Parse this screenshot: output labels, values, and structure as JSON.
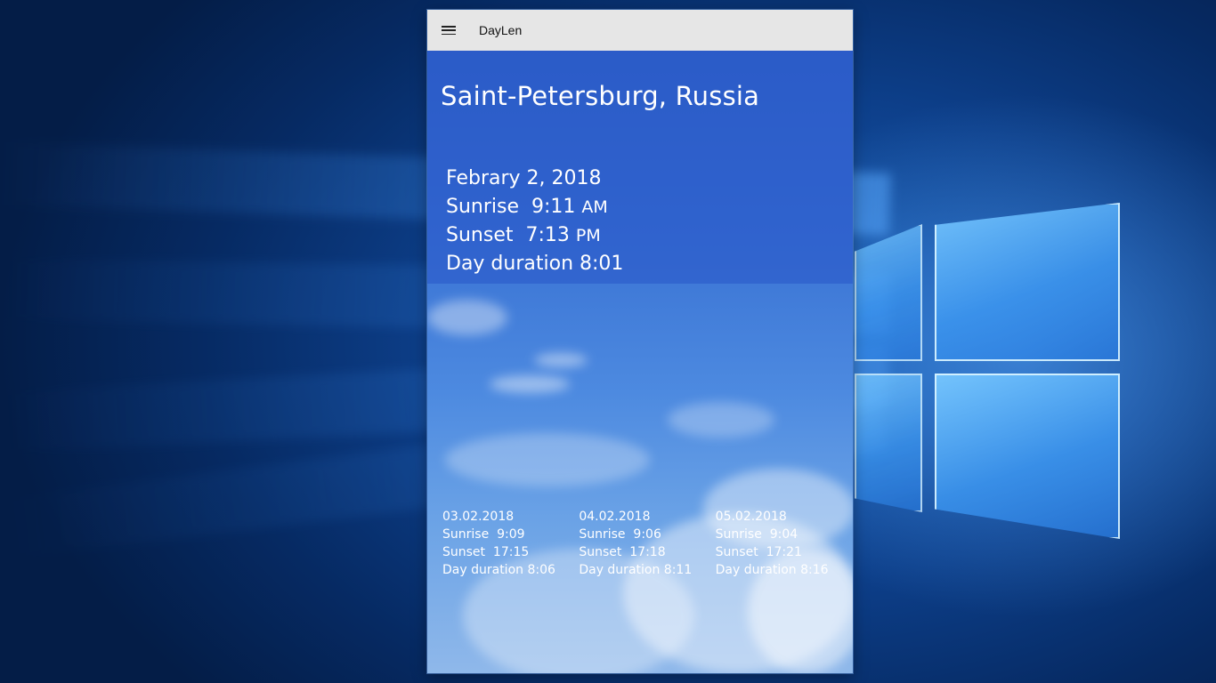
{
  "app": {
    "title": "DayLen",
    "menu_icon": "hamburger-icon"
  },
  "current": {
    "location": "Saint-Petersburg, Russia",
    "date": "Febrary 2, 2018",
    "sunrise_label": "Sunrise",
    "sunrise_time": "9:11",
    "sunrise_ampm": "AM",
    "sunset_label": "Sunset",
    "sunset_time": "7:13",
    "sunset_ampm": "PM",
    "duration_label": "Day duration",
    "duration_value": "8:01"
  },
  "forecast": [
    {
      "date": "03.02.2018",
      "sunrise": "Sunrise  9:09",
      "sunset": "Sunset  17:15",
      "duration": "Day duration 8:06"
    },
    {
      "date": "04.02.2018",
      "sunrise": "Sunrise  9:06",
      "sunset": "Sunset  17:18",
      "duration": "Day duration 8:11"
    },
    {
      "date": "05.02.2018",
      "sunrise": "Sunrise  9:04",
      "sunset": "Sunset  17:21",
      "duration": "Day duration 8:16"
    }
  ],
  "colors": {
    "title_bar": "#e6e6e6",
    "sky_top": "#2f63c7",
    "text": "#ffffff"
  }
}
